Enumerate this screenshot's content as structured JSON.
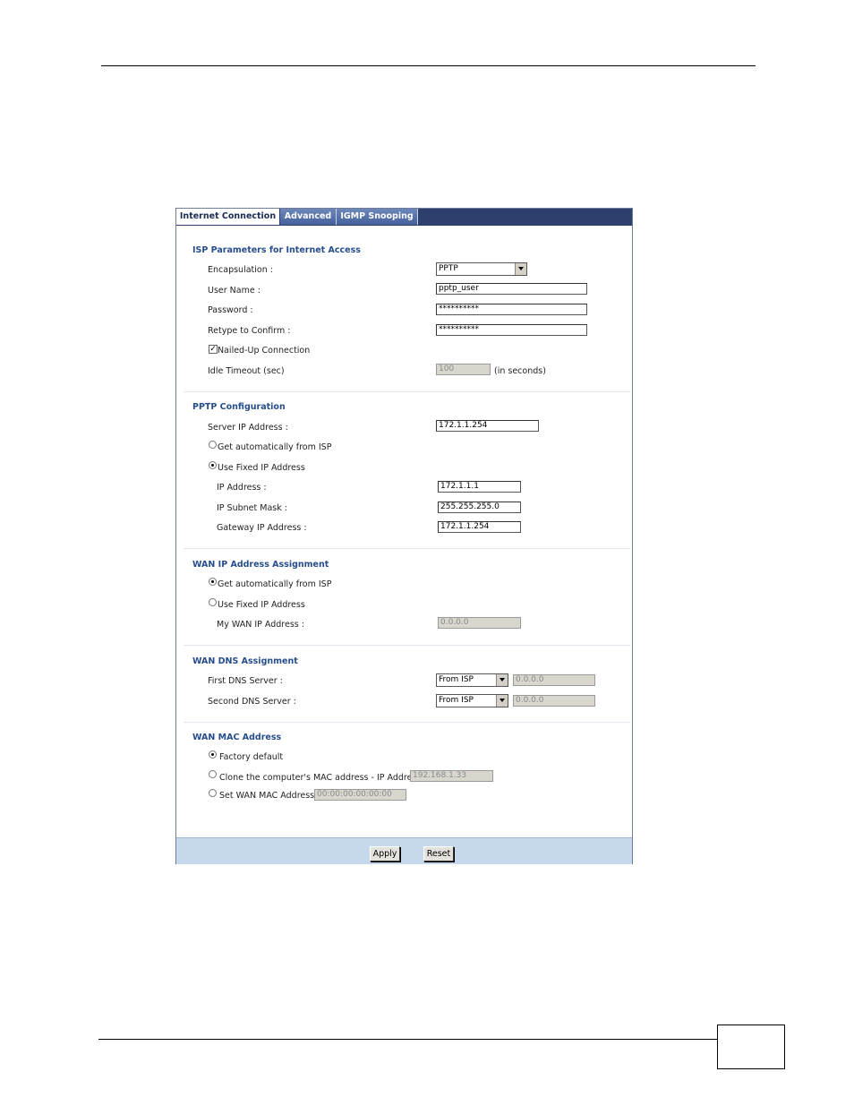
{
  "tabs": [
    {
      "label": "Internet Connection",
      "active": true
    },
    {
      "label": "Advanced",
      "active": false
    },
    {
      "label": "IGMP Snooping",
      "active": false
    }
  ],
  "isp": {
    "title": "ISP Parameters for Internet Access",
    "encapsulation_label": "Encapsulation :",
    "encapsulation_value": "PPTP",
    "username_label": "User Name :",
    "username_value": "pptp_user",
    "password_label": "Password :",
    "password_value": "**********",
    "retype_label": "Retype to Confirm :",
    "retype_value": "**********",
    "nailed_label": "Nailed-Up Connection",
    "nailed_checked": true,
    "idle_label": "Idle Timeout (sec)",
    "idle_value": "100",
    "idle_unit": "(in seconds)"
  },
  "pptp": {
    "title": "PPTP Configuration",
    "server_label": "Server IP Address :",
    "server_value": "172.1.1.254",
    "auto_label": "Get automatically from ISP",
    "fixed_label": "Use Fixed IP Address",
    "ip_label": "IP Address :",
    "ip_value": "172.1.1.1",
    "mask_label": "IP Subnet Mask :",
    "mask_value": "255.255.255.0",
    "gateway_label": "Gateway IP Address :",
    "gateway_value": "172.1.1.254"
  },
  "wan_ip": {
    "title": "WAN IP Address Assignment",
    "auto_label": "Get automatically from ISP",
    "fixed_label": "Use Fixed IP Address",
    "my_wan_label": "My WAN IP Address :",
    "my_wan_value": "0.0.0.0"
  },
  "wan_dns": {
    "title": "WAN DNS Assignment",
    "first_label": "First DNS Server :",
    "first_mode": "From ISP",
    "first_value": "0.0.0.0",
    "second_label": "Second DNS Server :",
    "second_mode": "From ISP",
    "second_value": "0.0.0.0"
  },
  "wan_mac": {
    "title": "WAN MAC Address",
    "factory_label": "Factory default",
    "clone_label": "Clone the computer's MAC address - IP Address",
    "clone_value": "192.168.1.33",
    "set_label": "Set WAN MAC Address",
    "set_value": "00:00:00:00:00:00"
  },
  "buttons": {
    "apply": "Apply",
    "reset": "Reset"
  }
}
